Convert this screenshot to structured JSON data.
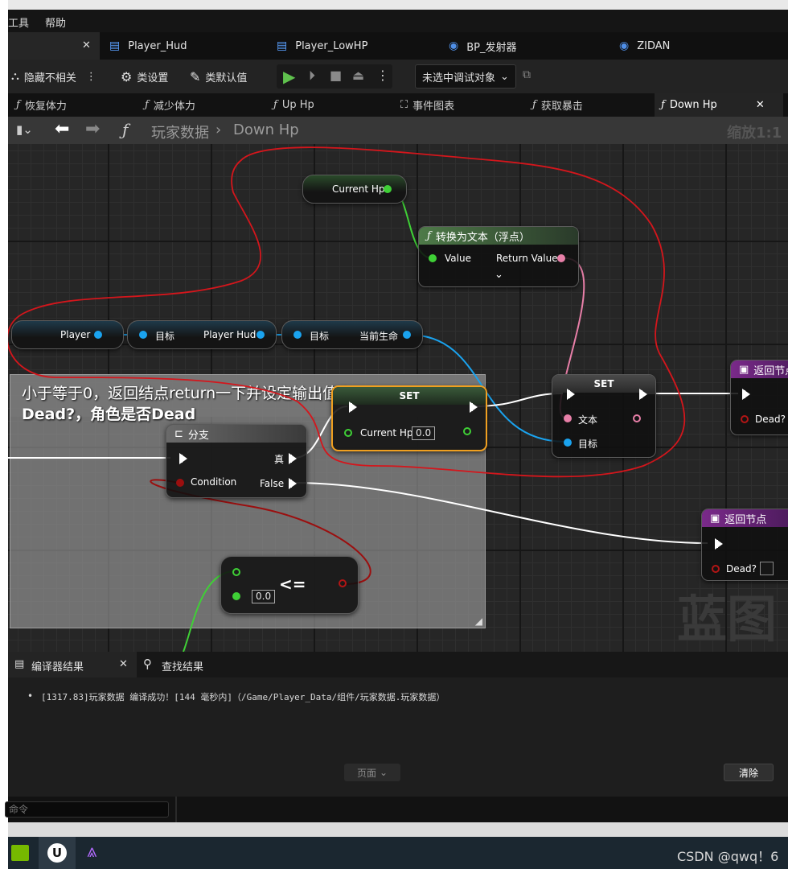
{
  "menu": {
    "tools": "工具",
    "help": "帮助"
  },
  "asset_tabs": [
    {
      "label": "Player_Hud"
    },
    {
      "label": "Player_LowHP"
    },
    {
      "label": "BP_发射器"
    },
    {
      "label": "ZIDAN"
    }
  ],
  "toolbar": {
    "hide_unrelated": "隐藏不相关",
    "class_settings": "类设置",
    "class_defaults": "类默认值",
    "debug_target": "未选中调试对象"
  },
  "graph_tabs": [
    {
      "label": "恢复体力"
    },
    {
      "label": "减少体力"
    },
    {
      "label": "Up Hp"
    },
    {
      "label": "事件图表"
    },
    {
      "label": "获取暴击"
    },
    {
      "label": "Down Hp"
    }
  ],
  "breadcrumb": {
    "root": "玩家数据",
    "current": "Down Hp",
    "zoom": "缩放1:1"
  },
  "comment": {
    "line1": "小于等于0，返回结点return一下并设定输出值为",
    "line2": "Dead?，角色是否Dead"
  },
  "nodes": {
    "current_hp_getter": {
      "label": "Current Hp"
    },
    "convert_to_text": {
      "title": "转换为文本（浮点）",
      "input": "Value",
      "output": "Return Value"
    },
    "player_getter": {
      "label": "Player"
    },
    "player_hud_getter": {
      "target": "目标",
      "output": "Player Hud"
    },
    "current_life_getter": {
      "target": "目标",
      "output": "当前生命"
    },
    "set_text": {
      "title": "SET",
      "text_pin": "文本",
      "target_pin": "目标"
    },
    "set_hp": {
      "title": "SET",
      "pin": "Current Hp",
      "value": "0.0"
    },
    "branch": {
      "title": "分支",
      "condition": "Condition",
      "true_label": "真",
      "false_label": "False"
    },
    "compare": {
      "op": "<=",
      "value": "0.0"
    },
    "return_top": {
      "title": "返回节点",
      "pin": "Dead?"
    },
    "return_bottom": {
      "title": "返回节点",
      "pin": "Dead?"
    }
  },
  "watermark": "蓝图",
  "bottom_panel": {
    "tab_compiler": "编译器结果",
    "tab_find": "查找结果",
    "log_line": "[1317.83]玩家数据 编译成功！[144 毫秒内]（/Game/Player_Data/组件/玩家数据.玩家数据）",
    "pages": "页面",
    "clear": "清除"
  },
  "command_placeholder": "命令",
  "taskbar_right": "CSDN @qwq！6",
  "colors": {
    "exec": "#ffffff",
    "float_pin": "#3fd036",
    "object_pin": "#1aa3ef",
    "text_pin": "#e87fa8",
    "bool_pin": "#9b0f0f",
    "annotation_red": "#d4161c"
  }
}
